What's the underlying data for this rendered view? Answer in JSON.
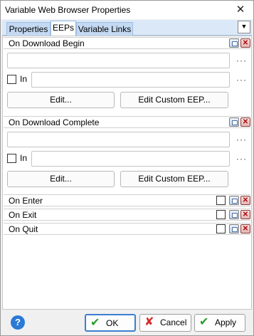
{
  "window": {
    "title": "Variable Web Browser Properties"
  },
  "tabs": [
    {
      "label": "Properties"
    },
    {
      "label": "EEPs"
    },
    {
      "label": "Variable Links"
    }
  ],
  "sections": {
    "download_begin": {
      "title": "On Download Begin",
      "in_label": "In",
      "edit_label": "Edit...",
      "edit_custom_label": "Edit Custom EEP..."
    },
    "download_complete": {
      "title": "On Download Complete",
      "in_label": "In",
      "edit_label": "Edit...",
      "edit_custom_label": "Edit Custom EEP..."
    },
    "on_enter": {
      "title": "On Enter"
    },
    "on_exit": {
      "title": "On Exit"
    },
    "on_quit": {
      "title": "On Quit"
    }
  },
  "footer": {
    "help_icon": "?",
    "ok_label": "OK",
    "cancel_label": "Cancel",
    "apply_label": "Apply"
  },
  "icons": {
    "ellipsis": "···",
    "close": "✕",
    "dropdown": "▼"
  },
  "colors": {
    "tab_strip": "#dbe8f7",
    "accent": "#3c7fd1",
    "ok_check": "#2a9d2a",
    "cancel_x": "#d62a2a"
  }
}
